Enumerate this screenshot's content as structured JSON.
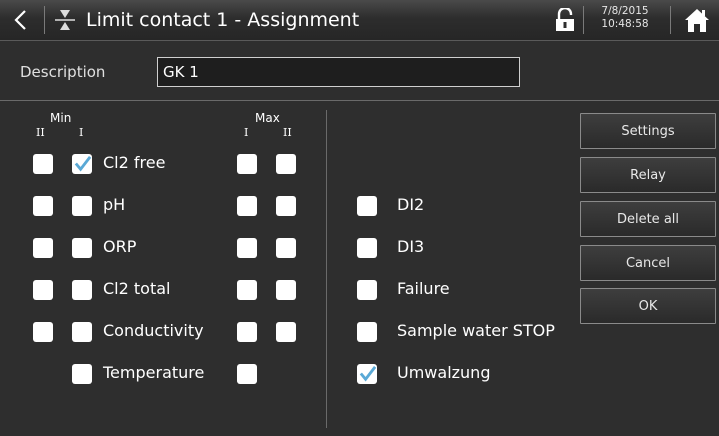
{
  "header": {
    "title": "Limit contact 1 - Assignment",
    "date": "7/8/2015",
    "time": "10:48:58",
    "icons": {
      "back": "back-arrow-icon",
      "title": "limit-contact-icon",
      "lock": "unlocked-padlock-icon",
      "home": "home-icon"
    }
  },
  "description": {
    "label": "Description",
    "value": "GK 1"
  },
  "columns": {
    "min_label": "Min",
    "max_label": "Max",
    "min_sub": [
      "II",
      "I"
    ],
    "max_sub": [
      "I",
      "II"
    ]
  },
  "left_rows": [
    {
      "label": "Cl2 free",
      "min_ii": false,
      "min_i": true,
      "max_i": false,
      "max_ii": false
    },
    {
      "label": "pH",
      "min_ii": false,
      "min_i": false,
      "max_i": false,
      "max_ii": false
    },
    {
      "label": "ORP",
      "min_ii": false,
      "min_i": false,
      "max_i": false,
      "max_ii": false
    },
    {
      "label": "Cl2 total",
      "min_ii": false,
      "min_i": false,
      "max_i": false,
      "max_ii": false
    },
    {
      "label": "Conductivity",
      "min_ii": false,
      "min_i": false,
      "max_i": false,
      "max_ii": false
    },
    {
      "label": "Temperature",
      "min_i": false,
      "max_i": false
    }
  ],
  "right_rows": [
    {
      "label": "DI2",
      "checked": false
    },
    {
      "label": "DI3",
      "checked": false
    },
    {
      "label": "Failure",
      "checked": false
    },
    {
      "label": "Sample water STOP",
      "checked": false
    },
    {
      "label": "Umwalzung",
      "checked": true
    }
  ],
  "buttons": {
    "settings": "Settings",
    "relay": "Relay",
    "delete_all": "Delete all",
    "cancel": "Cancel",
    "ok": "OK"
  },
  "colors": {
    "check": "#5aa9d6",
    "background": "#2e2e2e"
  }
}
